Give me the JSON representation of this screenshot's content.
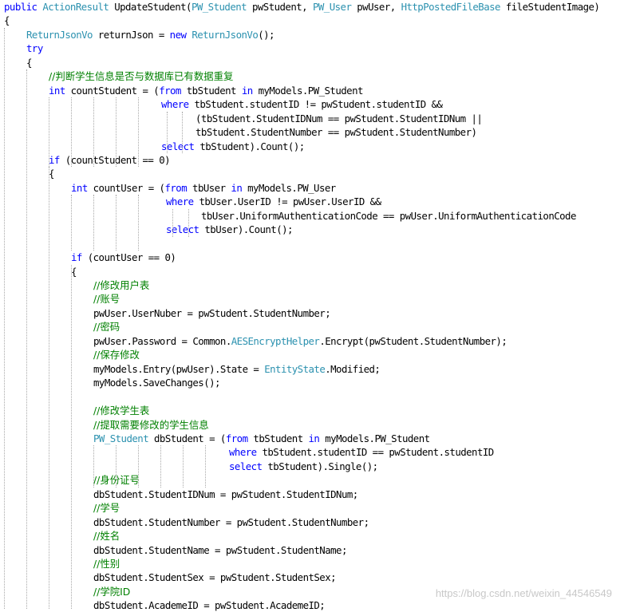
{
  "colors": {
    "keyword": "#0000ff",
    "type": "#2b91af",
    "comment": "#008000",
    "plain": "#000000",
    "guide": "#a8a8a8",
    "watermark": "#c8c8c8"
  },
  "code_lines": [
    [
      [
        "kw",
        "public "
      ],
      [
        "type",
        "ActionResult"
      ],
      [
        "p",
        " UpdateStudent("
      ],
      [
        "type",
        "PW_Student"
      ],
      [
        "p",
        " pwStudent, "
      ],
      [
        "type",
        "PW_User"
      ],
      [
        "p",
        " pwUser, "
      ],
      [
        "type",
        "HttpPostedFileBase"
      ],
      [
        "p",
        " fileStudentImage)"
      ]
    ],
    [
      [
        "p",
        "{"
      ]
    ],
    [
      [
        "type",
        "ReturnJsonVo"
      ],
      [
        "p",
        " returnJson = "
      ],
      [
        "kw",
        "new "
      ],
      [
        "type",
        "ReturnJsonVo"
      ],
      [
        "p",
        "();"
      ]
    ],
    [
      [
        "kw",
        "try"
      ]
    ],
    [
      [
        "p",
        "{"
      ]
    ],
    [
      [
        "cmt",
        "//判断学生信息是否与数据库已有数据重复"
      ]
    ],
    [
      [
        "kw",
        "int"
      ],
      [
        "p",
        " countStudent = ("
      ],
      [
        "kw",
        "from"
      ],
      [
        "p",
        " tbStudent "
      ],
      [
        "kw",
        "in"
      ],
      [
        "p",
        " myModels.PW_Student"
      ]
    ],
    [
      [
        "kw",
        "where"
      ],
      [
        "p",
        " tbStudent.studentID != pwStudent.studentID &&"
      ]
    ],
    [
      [
        "p",
        "(tbStudent.StudentIDNum == pwStudent.StudentIDNum ||"
      ]
    ],
    [
      [
        "p",
        "tbStudent.StudentNumber == pwStudent.StudentNumber)"
      ]
    ],
    [
      [
        "kw",
        "select"
      ],
      [
        "p",
        " tbStudent).Count();"
      ]
    ],
    [
      [
        "kw",
        "if"
      ],
      [
        "p",
        " (countStudent == 0)"
      ]
    ],
    [
      [
        "p",
        "{"
      ]
    ],
    [
      [
        "kw",
        "int"
      ],
      [
        "p",
        " countUser = ("
      ],
      [
        "kw",
        "from"
      ],
      [
        "p",
        " tbUser "
      ],
      [
        "kw",
        "in"
      ],
      [
        "p",
        " myModels.PW_User"
      ]
    ],
    [
      [
        "kw",
        "where"
      ],
      [
        "p",
        " tbUser.UserID != pwUser.UserID &&"
      ]
    ],
    [
      [
        "p",
        "tbUser.UniformAuthenticationCode == pwUser.UniformAuthenticationCode"
      ]
    ],
    [
      [
        "kw",
        "select"
      ],
      [
        "p",
        " tbUser).Count();"
      ]
    ],
    [],
    [
      [
        "kw",
        "if"
      ],
      [
        "p",
        " (countUser == 0)"
      ]
    ],
    [
      [
        "p",
        "{"
      ]
    ],
    [
      [
        "cmt",
        "//修改用户表"
      ]
    ],
    [
      [
        "cmt",
        "//账号"
      ]
    ],
    [
      [
        "p",
        "pwUser.UserNuber = pwStudent.StudentNumber;"
      ]
    ],
    [
      [
        "cmt",
        "//密码"
      ]
    ],
    [
      [
        "p",
        "pwUser.Password = Common."
      ],
      [
        "type",
        "AESEncryptHelper"
      ],
      [
        "p",
        ".Encrypt(pwStudent.StudentNumber);"
      ]
    ],
    [
      [
        "cmt",
        "//保存修改"
      ]
    ],
    [
      [
        "p",
        "myModels.Entry(pwUser).State = "
      ],
      [
        "type",
        "EntityState"
      ],
      [
        "p",
        ".Modified;"
      ]
    ],
    [
      [
        "p",
        "myModels.SaveChanges();"
      ]
    ],
    [],
    [
      [
        "cmt",
        "//修改学生表"
      ]
    ],
    [
      [
        "cmt",
        "//提取需要修改的学生信息"
      ]
    ],
    [
      [
        "type",
        "PW_Student"
      ],
      [
        "p",
        " dbStudent = ("
      ],
      [
        "kw",
        "from"
      ],
      [
        "p",
        " tbStudent "
      ],
      [
        "kw",
        "in"
      ],
      [
        "p",
        " myModels.PW_Student"
      ]
    ],
    [
      [
        "kw",
        "where"
      ],
      [
        "p",
        " tbStudent.studentID == pwStudent.studentID"
      ]
    ],
    [
      [
        "kw",
        "select"
      ],
      [
        "p",
        " tbStudent).Single();"
      ]
    ],
    [
      [
        "cmt",
        "//身份证号"
      ]
    ],
    [
      [
        "p",
        "dbStudent.StudentIDNum = pwStudent.StudentIDNum;"
      ]
    ],
    [
      [
        "cmt",
        "//学号"
      ]
    ],
    [
      [
        "p",
        "dbStudent.StudentNumber = pwStudent.StudentNumber;"
      ]
    ],
    [
      [
        "cmt",
        "//姓名"
      ]
    ],
    [
      [
        "p",
        "dbStudent.StudentName = pwStudent.StudentName;"
      ]
    ],
    [
      [
        "cmt",
        "//性别"
      ]
    ],
    [
      [
        "p",
        "dbStudent.StudentSex = pwStudent.StudentSex;"
      ]
    ],
    [
      [
        "cmt",
        "//学院ID"
      ]
    ],
    [
      [
        "p",
        "dbStudent.AcademeID = pwStudent.AcademeID;"
      ]
    ]
  ],
  "watermark": "https://blog.csdn.net/weixin_44546549"
}
